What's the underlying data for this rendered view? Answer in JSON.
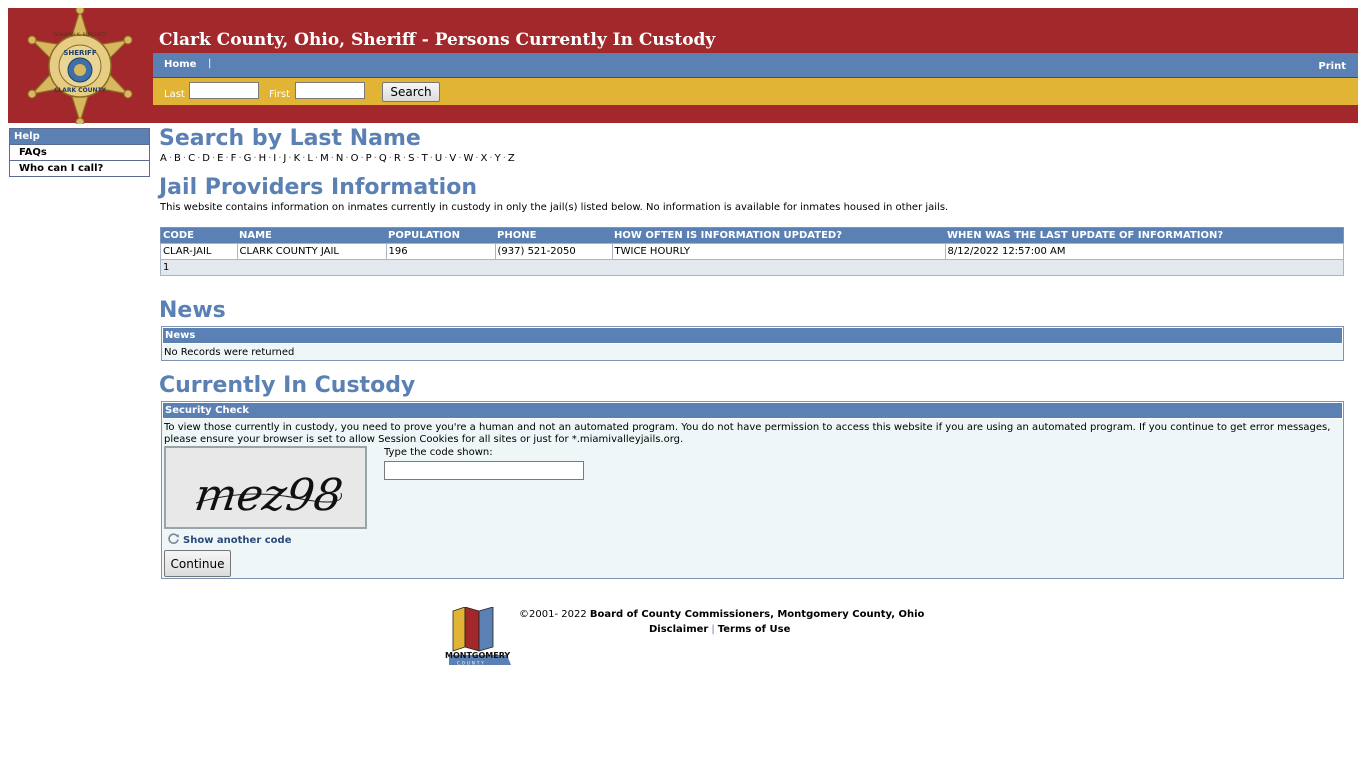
{
  "header": {
    "title": "Clark County, Ohio, Sheriff - Persons Currently In Custody",
    "badge_top_text": "DEBORAH K. BURCHETT",
    "badge_sheriff": "SHERIFF",
    "badge_county": "CLARK COUNTY",
    "nav": {
      "home": "Home",
      "separator": "|",
      "print": "Print"
    },
    "search": {
      "last_label": "Last",
      "last_value": "",
      "first_label": "First",
      "first_value": "",
      "button": "Search"
    }
  },
  "sidebar": {
    "header": "Help",
    "items": [
      {
        "label": "FAQs"
      },
      {
        "label": "Who can I call?"
      }
    ]
  },
  "search_by_name": {
    "title": "Search by Last Name",
    "letters": [
      "A",
      "B",
      "C",
      "D",
      "E",
      "F",
      "G",
      "H",
      "I",
      "J",
      "K",
      "L",
      "M",
      "N",
      "O",
      "P",
      "Q",
      "R",
      "S",
      "T",
      "U",
      "V",
      "W",
      "X",
      "Y",
      "Z"
    ],
    "separator": "·"
  },
  "jail_providers": {
    "title": "Jail Providers Information",
    "description": "This website contains information on inmates currently in custody in only the jail(s) listed below. No information is available for inmates housed in other jails.",
    "columns": [
      "CODE",
      "NAME",
      "POPULATION",
      "PHONE",
      "HOW OFTEN IS INFORMATION UPDATED?",
      "WHEN WAS THE LAST UPDATE OF INFORMATION?"
    ],
    "rows": [
      [
        "CLAR-JAIL",
        "CLARK COUNTY JAIL",
        "196",
        "(937) 521-2050",
        "TWICE HOURLY",
        "8/12/2022 12:57:00 AM"
      ]
    ],
    "pager": "1"
  },
  "news": {
    "title": "News",
    "panel_header": "News",
    "empty_text": "No Records were returned"
  },
  "custody": {
    "title": "Currently In Custody",
    "panel_header": "Security Check",
    "security_text": "To view those currently in custody, you need to prove you're a human and not an automated program. You do not have permission to access this website if you are using an automated program. If you continue to get error messages, please ensure your browser is set to allow Session Cookies for all sites or just for *.miamivalleyjails.org.",
    "captcha_text": "mez98",
    "code_label": "Type the code shown:",
    "code_value": "",
    "show_another": "Show another code",
    "continue_button": "Continue"
  },
  "footer": {
    "copyright_prefix": "©2001- 2022 ",
    "copyright_owner": "Board of County Commissioners, Montgomery County, Ohio",
    "logo_text": "MONTGOMERY",
    "logo_subtext": "COUNTY",
    "links": {
      "disclaimer": "Disclaimer",
      "separator": "|",
      "terms": "Terms of Use"
    }
  },
  "colors": {
    "header_red": "#a3282c",
    "nav_blue": "#5b80b4",
    "search_gold": "#e2b435",
    "panel_bg": "#eef6f8"
  }
}
